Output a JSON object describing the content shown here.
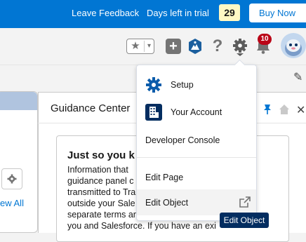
{
  "trial_banner": {
    "feedback_label": "Leave Feedback",
    "days_label": "Days left in trial",
    "days_count": "29",
    "buy_label": "Buy Now"
  },
  "header": {
    "notification_count": "10",
    "help_glyph": "?",
    "plus_glyph": "+",
    "star_glyph": "★",
    "caret_glyph": "▾",
    "icons": [
      "star-icon",
      "chevron-down-icon",
      "plus-icon",
      "trailhead-icon",
      "help-icon",
      "gear-icon",
      "bell-icon",
      "avatar"
    ]
  },
  "background": {
    "guidance_title": "Guidance Center",
    "card_heading": "Just so you k",
    "card_lines": [
      "Information that",
      "guidance panel c",
      "transmitted to Tra",
      "outside your Sale",
      "separate terms ar",
      "you and Salesforce. If you have an exi"
    ],
    "view_all": "ew All",
    "pencil_glyph": "✎",
    "close_glyph": "✕"
  },
  "setup_menu": {
    "items": [
      {
        "label": "Setup",
        "icon": "setup-gear-icon"
      },
      {
        "label": "Your Account",
        "icon": "building-icon"
      },
      {
        "label": "Developer Console"
      },
      {
        "label": "Edit Page"
      },
      {
        "label": "Edit Object",
        "icon": "external-link-icon"
      }
    ],
    "tooltip": "Edit Object"
  },
  "colors": {
    "brand_blue": "#0176d3",
    "trial_count_bg": "#fff8c4",
    "notification_red": "#ba0517",
    "tooltip_bg": "#032d60"
  }
}
